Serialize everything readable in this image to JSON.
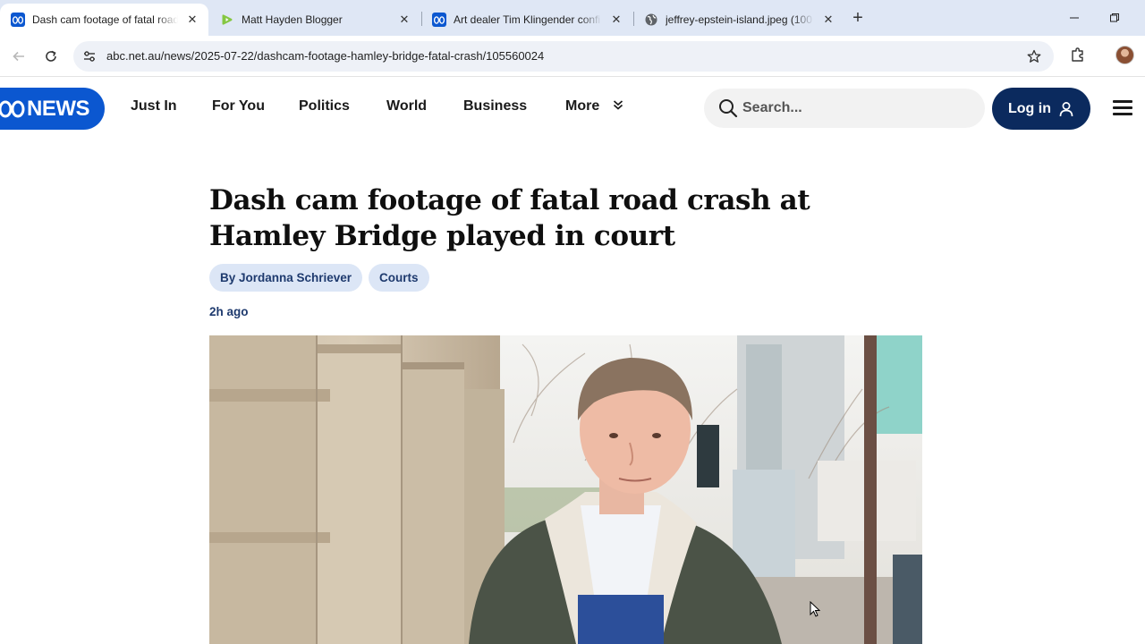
{
  "browser": {
    "tabs": [
      {
        "title": "Dash cam footage of fatal road crash at Hamley",
        "icon": "abc-favicon",
        "active": true
      },
      {
        "title": "Matt Hayden Blogger",
        "icon": "rumble-favicon",
        "active": false
      },
      {
        "title": "Art dealer Tim Klingender confi",
        "icon": "abc-favicon",
        "active": false
      },
      {
        "title": "jeffrey-epstein-island.jpeg (100",
        "icon": "globe-icon",
        "active": false
      }
    ],
    "new_tab": "+",
    "url": "abc.net.au/news/2025-07-22/dashcam-footage-hamley-bridge-fatal-crash/105560024"
  },
  "site": {
    "logo_text": "NEWS",
    "nav": [
      "Just In",
      "For You",
      "Politics",
      "World",
      "Business",
      "More"
    ],
    "search_placeholder": "Search...",
    "login_label": "Log in",
    "brand_color": "#0b57d0",
    "login_color": "#0b2a5e"
  },
  "article": {
    "headline": "Dash cam footage of fatal road crash at Hamley Bridge played in court",
    "byline": "By Jordanna Schriever",
    "topic": "Courts",
    "time": "2h ago"
  }
}
